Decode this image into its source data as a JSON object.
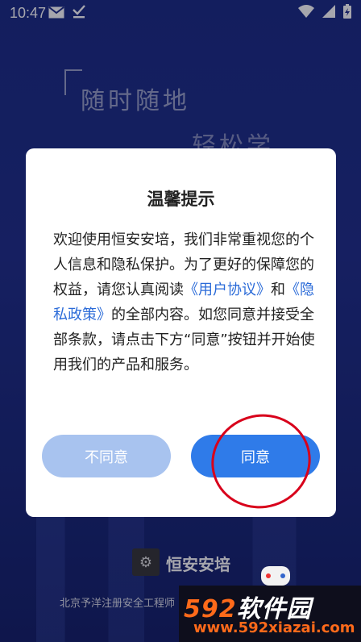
{
  "status_bar": {
    "time": "10:47"
  },
  "background": {
    "slogan_line1": "随时随地",
    "slogan_line2": "轻松学"
  },
  "dialog": {
    "title": "温馨提示",
    "body_part1": "欢迎使用恒安安培，我们非常重视您的个人信息和隐私保护。为了更好的保障您的权益，请您认真阅读",
    "link_user_agreement": "《用户协议》",
    "and": "和",
    "link_privacy_policy": "《隐私政策》",
    "body_part2": "的全部内容。如您同意并接受全部条款，请点击下方“同意”按钮并开始使用我们的产品和服务。",
    "disagree_label": "不同意",
    "agree_label": "同意"
  },
  "footer": {
    "app_name": "恒安安培",
    "company": "北京予洋注册安全工程师"
  },
  "watermark": {
    "number": "592",
    "name": "软件园",
    "url": "www.592xiazai.com"
  },
  "colors": {
    "agree": "#2f7be9",
    "disagree": "#a8c3ef",
    "link": "#2b6bd8",
    "circle_annotation": "#d8001b"
  }
}
